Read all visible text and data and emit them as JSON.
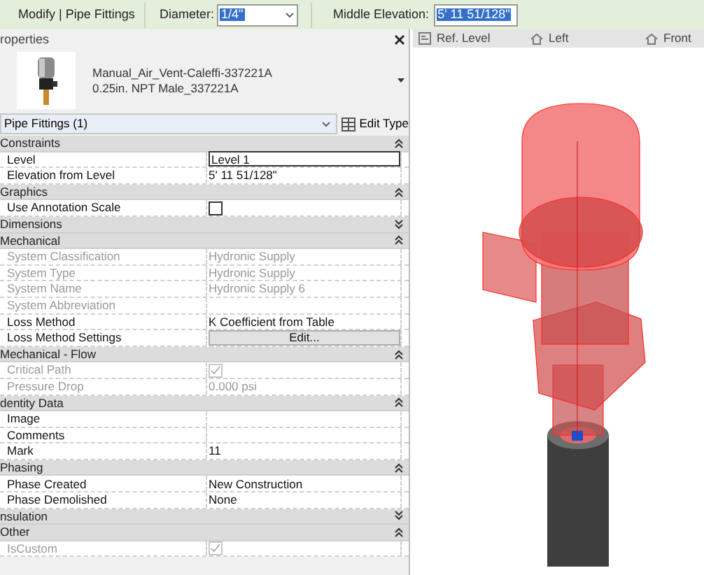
{
  "toolbar": {
    "context": "Modify | Pipe Fittings",
    "diameter": {
      "label": "Diameter:",
      "value": "1/4\""
    },
    "elevation": {
      "label": "Middle Elevation:",
      "value": "5'  11 51/128\""
    }
  },
  "properties": {
    "title": "roperties",
    "type_name": "Manual_Air_Vent-Caleffi-337221A",
    "type_sub": "0.25in. NPT Male_337221A",
    "selector": "Pipe Fittings (1)",
    "edit_type": "Edit Type",
    "groups": [
      {
        "name": "Constraints",
        "expanded": true,
        "rows": [
          {
            "label": "Level",
            "value": "Level 1",
            "kind": "input",
            "disabled": false
          },
          {
            "label": "Elevation from Level",
            "value": "5'  11 51/128\"",
            "kind": "text",
            "disabled": false
          }
        ]
      },
      {
        "name": "Graphics",
        "expanded": true,
        "rows": [
          {
            "label": "Use Annotation Scale",
            "kind": "checkbox",
            "checked": false,
            "disabled": false
          }
        ]
      },
      {
        "name": "Dimensions",
        "expanded": false
      },
      {
        "name": "Mechanical",
        "expanded": true,
        "rows": [
          {
            "label": "System Classification",
            "value": "Hydronic Supply",
            "kind": "text",
            "disabled": true
          },
          {
            "label": "System Type",
            "value": "Hydronic Supply",
            "kind": "text",
            "disabled": true
          },
          {
            "label": "System Name",
            "value": "Hydronic Supply 6",
            "kind": "text",
            "disabled": true
          },
          {
            "label": "System Abbreviation",
            "kind": "text",
            "disabled": true
          },
          {
            "label": "Loss Method",
            "value": "K Coefficient from Table",
            "kind": "text",
            "disabled": false
          },
          {
            "label": "Loss Method Settings",
            "value": "Edit...",
            "kind": "button",
            "disabled": false
          }
        ]
      },
      {
        "name": "Mechanical - Flow",
        "expanded": true,
        "rows": [
          {
            "label": "Critical Path",
            "kind": "checkbox",
            "checked": true,
            "disabled": true
          },
          {
            "label": "Pressure Drop",
            "value": "0.000 psi",
            "kind": "text",
            "disabled": true
          }
        ]
      },
      {
        "name": "dentity Data",
        "expanded": true,
        "rows": [
          {
            "label": "Image",
            "kind": "text",
            "disabled": false
          },
          {
            "label": "Comments",
            "kind": "text",
            "disabled": false
          },
          {
            "label": "Mark",
            "value": "11",
            "kind": "text",
            "disabled": false
          }
        ]
      },
      {
        "name": "Phasing",
        "expanded": true,
        "rows": [
          {
            "label": "Phase Created",
            "value": "New Construction",
            "kind": "text",
            "disabled": false
          },
          {
            "label": "Phase Demolished",
            "value": "None",
            "kind": "text",
            "disabled": false
          }
        ]
      },
      {
        "name": "nsulation",
        "expanded": false
      },
      {
        "name": "Other",
        "expanded": true,
        "rows": [
          {
            "label": "IsCustom",
            "kind": "checkbox",
            "checked": true,
            "disabled": true
          }
        ]
      }
    ]
  },
  "view_tabs": [
    "Ref. Level",
    "Left",
    "Front"
  ]
}
